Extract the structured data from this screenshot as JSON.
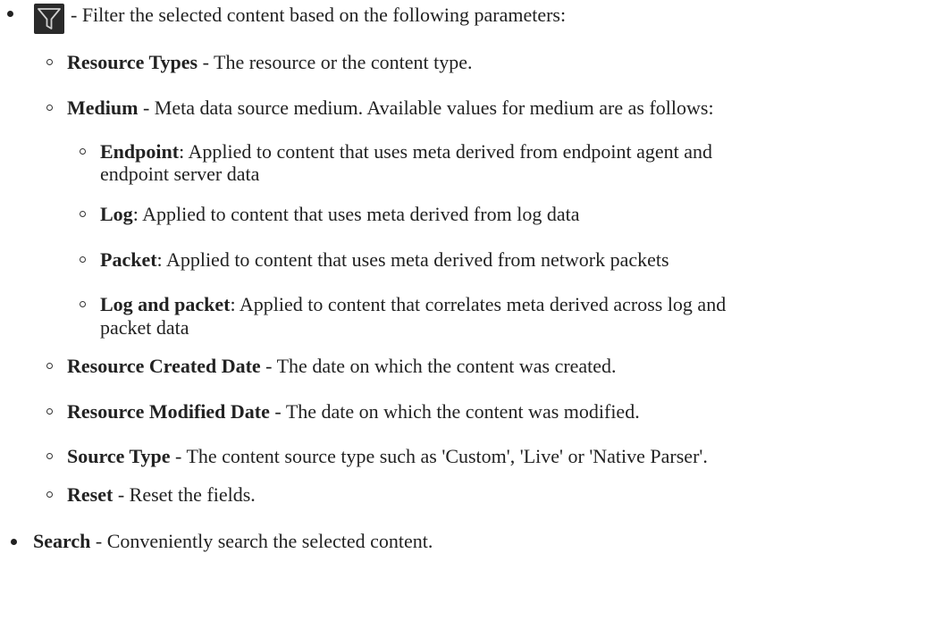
{
  "filter": {
    "icon": "filter-funnel-icon",
    "description": "- Filter the selected content based on the following parameters:",
    "params": [
      {
        "term": "Resource Types",
        "sep": " - ",
        "desc": "The resource or the content type."
      },
      {
        "term": "Medium",
        "sep": " - ",
        "desc": "Meta data source medium. Available values for medium are as follows:",
        "values": [
          {
            "term": "Endpoint",
            "sep": ": ",
            "desc_line1": "Applied to content that uses meta derived from endpoint agent and",
            "desc_line2": "endpoint server data"
          },
          {
            "term": "Log",
            "sep": ": ",
            "desc_line1": "Applied to content that uses meta derived from log data"
          },
          {
            "term": "Packet",
            "sep": ": ",
            "desc_line1": "Applied to content that uses meta derived from network packets"
          },
          {
            "term": "Log and packet",
            "sep": ": ",
            "desc_line1": "Applied to content that correlates meta derived across log and",
            "desc_line2": "packet data"
          }
        ]
      },
      {
        "term": "Resource Created Date",
        "sep": " - ",
        "desc": "The date on which the content was created."
      },
      {
        "term": "Resource Modified Date",
        "sep": " - ",
        "desc": "The date on which the content was modified."
      },
      {
        "term": "Source Type",
        "sep": " - ",
        "desc": "The content source type such as 'Custom', 'Live' or 'Native Parser'."
      },
      {
        "term": "Reset",
        "sep": " - ",
        "desc": "Reset the fields."
      }
    ]
  },
  "search": {
    "term": "Search",
    "sep": " - ",
    "desc": "Conveniently search the selected content."
  }
}
